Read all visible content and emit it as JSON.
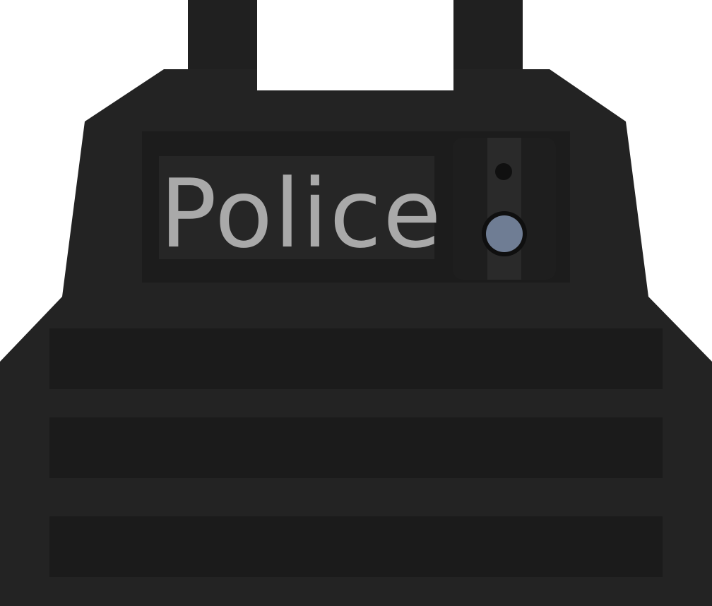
{
  "item": {
    "patch_label": "Police"
  },
  "colors": {
    "background": "#ffffff",
    "vest_body": "#232323",
    "vest_shadow": "#1b1b1b",
    "strap": "#202020",
    "strap_end": "#252525",
    "patch_frame": "#1c1c1c",
    "patch_panel": "#262626",
    "patch_text": "#a9a9a9",
    "radio_body": "#1e1e1e",
    "radio_edge": "#2a2a2a",
    "radio_lens_ring": "#0f0f0f",
    "radio_lens": "#6f7d94",
    "radio_dot": "#101010"
  },
  "icons": {
    "vest": "ballistic-vest-icon",
    "radio": "shoulder-radio-icon"
  }
}
